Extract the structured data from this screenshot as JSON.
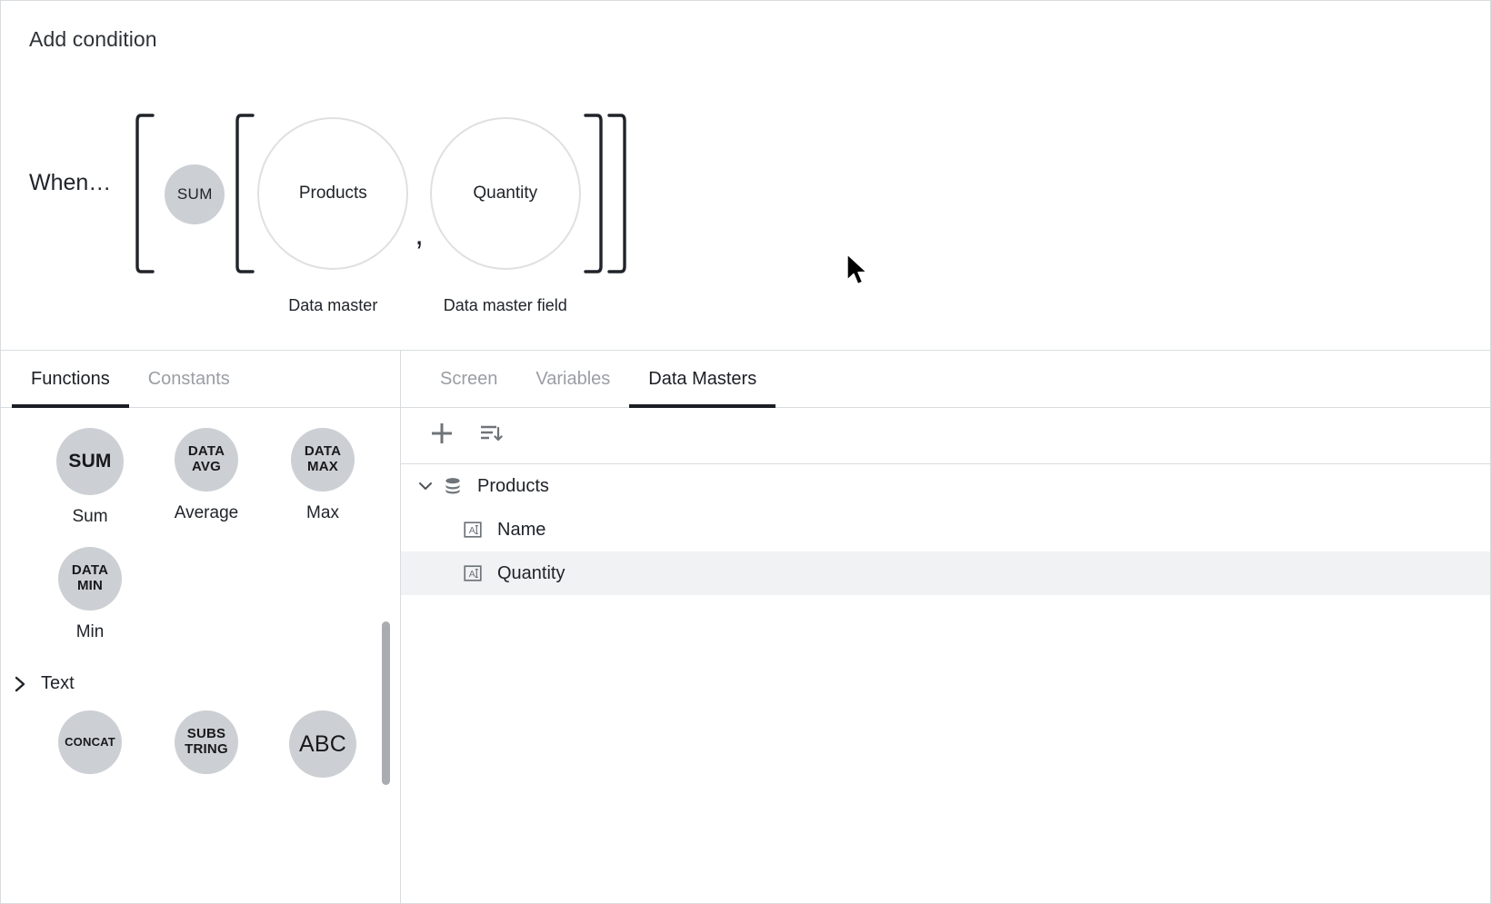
{
  "condition": {
    "title": "Add condition",
    "when_label": "When…",
    "function_token": "SUM",
    "comma": ",",
    "slots": [
      {
        "value": "Products",
        "caption": "Data master"
      },
      {
        "value": "Quantity",
        "caption": "Data master field"
      }
    ]
  },
  "left_panel": {
    "tabs": [
      {
        "label": "Functions",
        "active": true
      },
      {
        "label": "Constants",
        "active": false
      }
    ],
    "groups": [
      {
        "name": "",
        "expanded": true,
        "functions": [
          {
            "glyph": "SUM",
            "label": "Sum",
            "size": "big"
          },
          {
            "glyph": "DATA\nAVG",
            "label": "Average",
            "size": "med"
          },
          {
            "glyph": "DATA\nMAX",
            "label": "Max",
            "size": "med"
          },
          {
            "glyph": "DATA\nMIN",
            "label": "Min",
            "size": "med"
          }
        ]
      },
      {
        "name": "Text",
        "expanded": false,
        "functions": [
          {
            "glyph": "CONCAT",
            "label": "",
            "size": "wide"
          },
          {
            "glyph": "SUBS\nTRING",
            "label": "",
            "size": "med"
          },
          {
            "glyph": "ABC",
            "label": "",
            "size": "abc"
          }
        ]
      }
    ]
  },
  "right_panel": {
    "tabs": [
      {
        "label": "Screen",
        "active": false
      },
      {
        "label": "Variables",
        "active": false
      },
      {
        "label": "Data Masters",
        "active": true
      }
    ],
    "toolbar": [
      {
        "icon": "plus-icon"
      },
      {
        "icon": "sort-descending-icon"
      }
    ],
    "tree": [
      {
        "label": "Products",
        "icon": "database-icon",
        "expanded": true,
        "selected": false,
        "children": [
          {
            "label": "Name",
            "icon": "text-field-icon",
            "selected": false
          },
          {
            "label": "Quantity",
            "icon": "text-field-icon",
            "selected": true
          }
        ]
      }
    ]
  },
  "colors": {
    "token_fill": "#ccd0d4",
    "border": "#d9dcdf",
    "text": "#20242a",
    "muted_text": "#9a9ea3",
    "selected_row": "#f1f2f3",
    "active_underline": "#1b1f24"
  }
}
